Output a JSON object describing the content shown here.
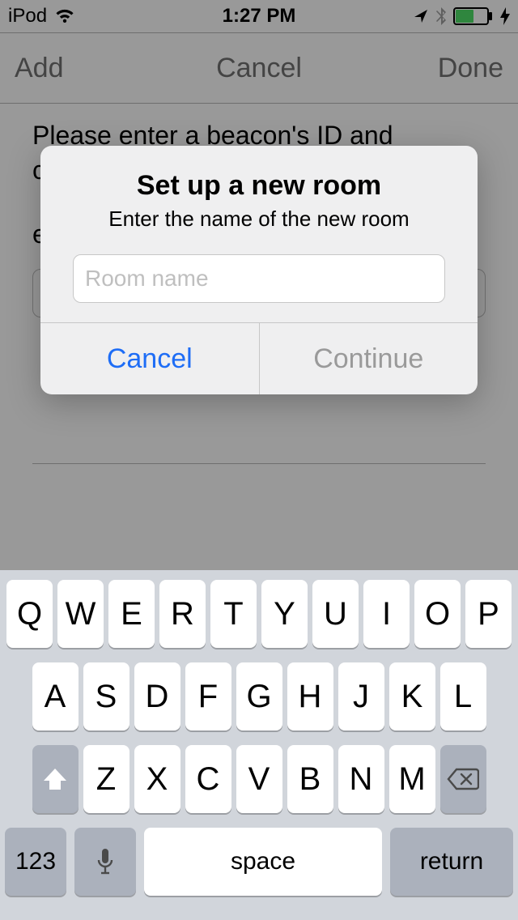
{
  "status": {
    "device": "iPod",
    "time": "1:27 PM"
  },
  "nav": {
    "left": "Add",
    "center": "Cancel",
    "right": "Done"
  },
  "content": {
    "prompt_line1": "Please enter a beacon's ID and",
    "prompt_line2_frag": "c",
    "prompt_line3_frag": "e"
  },
  "alert": {
    "title": "Set up a new room",
    "message": "Enter the name of the new room",
    "placeholder": "Room name",
    "value": "",
    "cancel": "Cancel",
    "continue": "Continue"
  },
  "keyboard": {
    "row1": [
      "Q",
      "W",
      "E",
      "R",
      "T",
      "Y",
      "U",
      "I",
      "O",
      "P"
    ],
    "row2": [
      "A",
      "S",
      "D",
      "F",
      "G",
      "H",
      "J",
      "K",
      "L"
    ],
    "row3": [
      "Z",
      "X",
      "C",
      "V",
      "B",
      "N",
      "M"
    ],
    "numbers": "123",
    "space": "space",
    "return": "return"
  }
}
